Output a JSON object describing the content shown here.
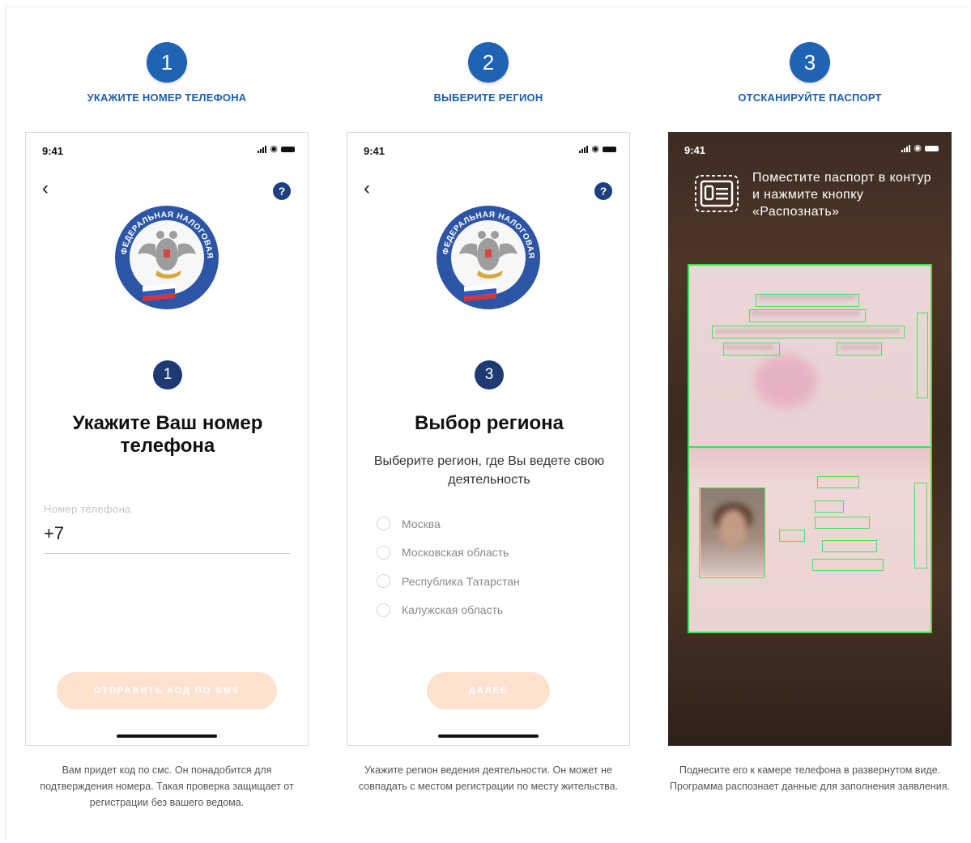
{
  "steps": [
    {
      "number": "1",
      "title": "УКАЖИТЕ НОМЕР ТЕЛЕФОНА",
      "status_time": "9:41",
      "badge": "1",
      "heading": "Укажите Ваш номер телефона",
      "phone_label": "Номер телефона",
      "phone_value": "+7",
      "button_label": "ОТПРАВИТЬ КОД ПО SMS",
      "caption": "Вам придет код по смс. Он понадобится для подтверждения номера. Такая проверка защищает от регистрации без вашего ведома."
    },
    {
      "number": "2",
      "title": "ВЫБЕРИТЕ РЕГИОН",
      "status_time": "9:41",
      "badge": "3",
      "heading": "Выбор региона",
      "subheading": "Выберите регион, где Вы ведете свою деятельность",
      "regions": [
        "Москва",
        "Московская область",
        "Республика Татарстан",
        "Калужская область"
      ],
      "button_label": "ДАЛЕЕ",
      "caption": "Укажите регион ведения деятельности. Он может не совпадать с местом регистрации по месту жительства."
    },
    {
      "number": "3",
      "title": "ОТСКАНИРУЙТЕ ПАСПОРТ",
      "status_time": "9:41",
      "instruction": "Поместите паспорт в контур и нажмите кнопку «Распознать»",
      "caption": "Поднесите его к камере телефона в развернутом виде. Программа распознает данные для заполнения заявления."
    }
  ],
  "emblem_text": "ФЕДЕРАЛЬНАЯ НАЛОГОВАЯ СЛУЖБА",
  "icons": {
    "back": "chevron-left-icon",
    "help": "question-icon",
    "scan": "passport-scan-icon"
  },
  "colors": {
    "step_blue": "#1f64b4",
    "badge_navy": "#1e3a75",
    "button_peach": "#fde2d0",
    "scan_green": "#37e24c"
  }
}
